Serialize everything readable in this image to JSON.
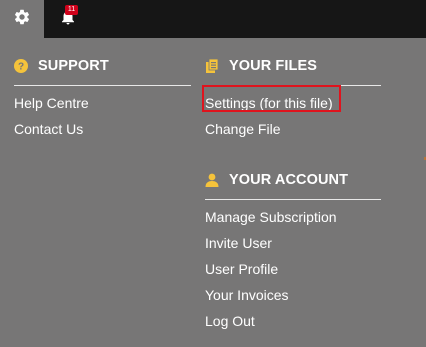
{
  "topbar": {
    "notification_count": "11"
  },
  "support": {
    "title": "SUPPORT",
    "links": [
      "Help Centre",
      "Contact Us"
    ]
  },
  "files": {
    "title": "YOUR FILES",
    "links": [
      "Settings (for this file)",
      "Change File"
    ]
  },
  "account": {
    "title": "YOUR ACCOUNT",
    "links": [
      "Manage Subscription",
      "Invite User",
      "User Profile",
      "Your Invoices",
      "Log Out"
    ]
  },
  "colors": {
    "menu_background": "#777676",
    "topbar_background": "#161616",
    "icon_accent": "#f5c33b",
    "badge": "#d0021b",
    "highlight_box": "#e0131d"
  }
}
